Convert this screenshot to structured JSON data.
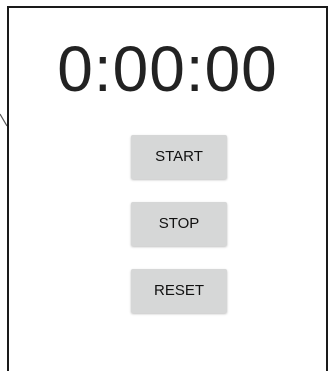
{
  "stopwatch": {
    "display": "0:00:00",
    "buttons": {
      "start_label": "START",
      "stop_label": "STOP",
      "reset_label": "RESET"
    }
  },
  "colors": {
    "background": "#ffffff",
    "button": "#d6d7d7",
    "text": "#222222",
    "frame_border": "#1a1a1a"
  }
}
